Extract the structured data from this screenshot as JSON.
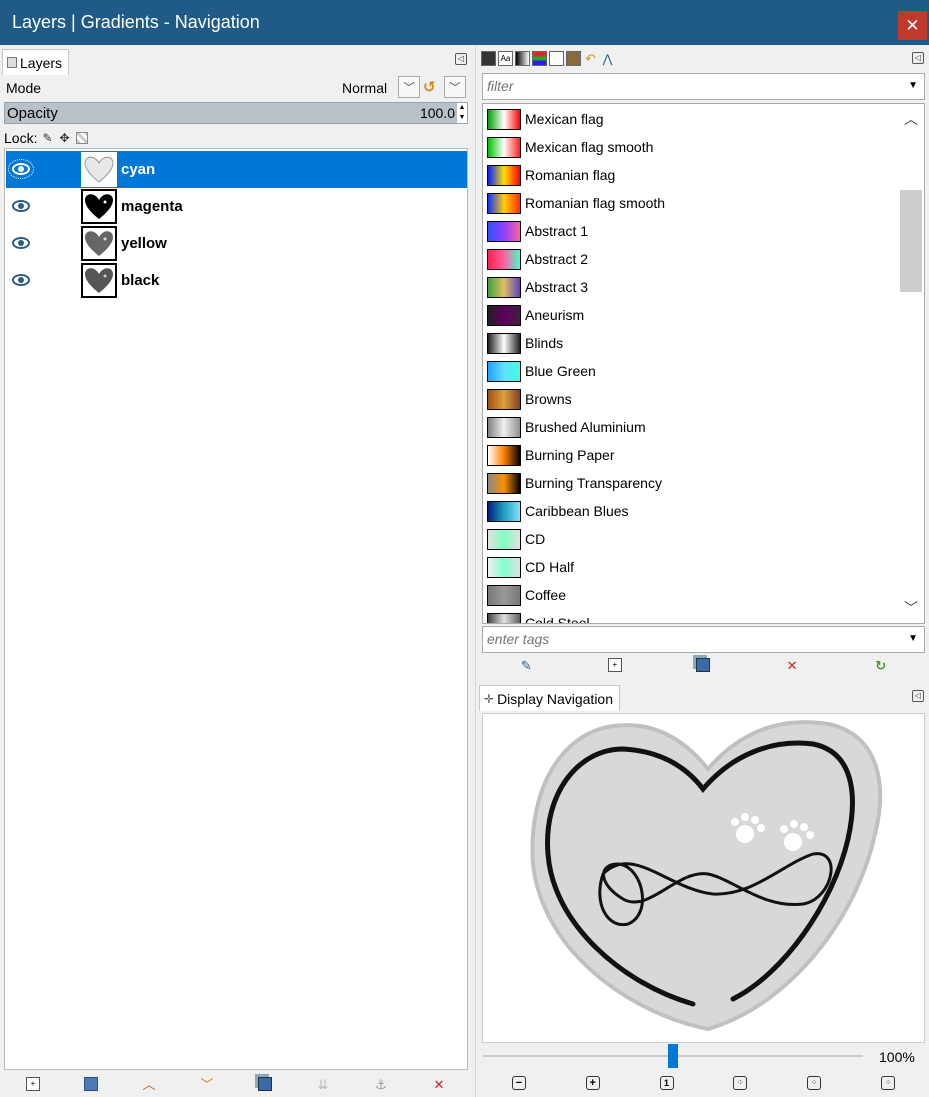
{
  "window": {
    "title": "Layers | Gradients - Navigation",
    "close_icon": "close-icon"
  },
  "layers": {
    "tab_label": "Layers",
    "mode_label": "Mode",
    "mode_value": "Normal",
    "opacity_label": "Opacity",
    "opacity_value": "100.0",
    "lock_label": "Lock:",
    "items": [
      {
        "name": "cyan",
        "selected": true
      },
      {
        "name": "magenta",
        "selected": false
      },
      {
        "name": "yellow",
        "selected": false
      },
      {
        "name": "black",
        "selected": false
      }
    ],
    "bottom_icons": [
      "new-layer-icon",
      "new-group-icon",
      "raise-icon",
      "lower-icon",
      "duplicate-icon",
      "merge-icon",
      "anchor-icon",
      "delete-icon"
    ]
  },
  "gradients": {
    "filter_placeholder": "filter",
    "tags_placeholder": "enter tags",
    "items": [
      {
        "name": "Mexican flag",
        "colors": [
          "#00a000",
          "#ffffff",
          "#ff0000"
        ]
      },
      {
        "name": "Mexican flag smooth",
        "colors": [
          "#00c000",
          "#ffffff",
          "#ff2020"
        ]
      },
      {
        "name": "Romanian flag",
        "colors": [
          "#0020ff",
          "#ffe000",
          "#ff0000"
        ]
      },
      {
        "name": "Romanian flag smooth",
        "colors": [
          "#1030ff",
          "#ffd000",
          "#ff3000"
        ]
      },
      {
        "name": "Abstract 1",
        "colors": [
          "#3050ff",
          "#9040ff",
          "#ff60a0"
        ]
      },
      {
        "name": "Abstract 2",
        "colors": [
          "#ff2050",
          "#ff60a0",
          "#40ffd0"
        ]
      },
      {
        "name": "Abstract 3",
        "colors": [
          "#40a040",
          "#e0c060",
          "#6040c0"
        ]
      },
      {
        "name": "Aneurism",
        "colors": [
          "#202020",
          "#600060",
          "#402040"
        ]
      },
      {
        "name": "Blinds",
        "colors": [
          "#202020",
          "#ffffff",
          "#202020"
        ]
      },
      {
        "name": "Blue Green",
        "colors": [
          "#20a0ff",
          "#60e0ff",
          "#40ffe0"
        ]
      },
      {
        "name": "Browns",
        "colors": [
          "#a05010",
          "#e0a040",
          "#804020"
        ]
      },
      {
        "name": "Brushed Aluminium",
        "colors": [
          "#808080",
          "#f0f0f0",
          "#909090"
        ]
      },
      {
        "name": "Burning Paper",
        "colors": [
          "#ffffff",
          "#ff8000",
          "#000000"
        ]
      },
      {
        "name": "Burning Transparency",
        "colors": [
          "#888888",
          "#ff9000",
          "#000000"
        ]
      },
      {
        "name": "Caribbean Blues",
        "colors": [
          "#002080",
          "#20a0c0",
          "#80e0ff"
        ]
      },
      {
        "name": "CD",
        "colors": [
          "#e0e0e0",
          "#80ffc0",
          "#e0e0e0"
        ]
      },
      {
        "name": "CD Half",
        "colors": [
          "#f0f0f0",
          "#80ffd0",
          "#e0e0e0"
        ]
      },
      {
        "name": "Coffee",
        "colors": [
          "#777777",
          "#999999",
          "#777777"
        ]
      },
      {
        "name": "Cold Steel",
        "colors": [
          "#404040",
          "#e0e0e0",
          "#606060"
        ]
      }
    ]
  },
  "navigation": {
    "tab_label": "Display Navigation",
    "zoom": "100%",
    "zoom_fraction": 0.5,
    "bottom_icons": [
      "zoom-out-icon",
      "zoom-in-icon",
      "zoom-1-1-icon",
      "fit-image-icon",
      "fill-window-icon",
      "shrink-wrap-icon"
    ]
  }
}
